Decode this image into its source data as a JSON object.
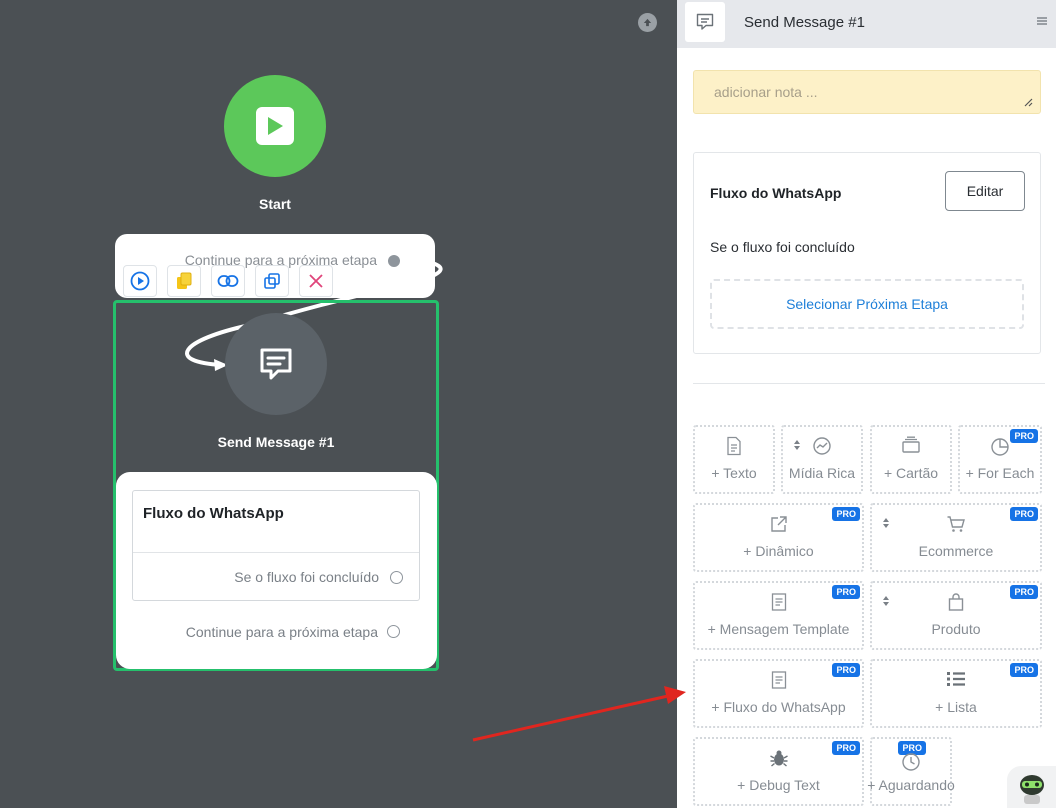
{
  "canvas": {
    "start": {
      "label": "Start",
      "continue_text": "Continue para a próxima etapa"
    },
    "toolbar": {
      "buttons": [
        "play-circle-icon",
        "copy-yellow-icon",
        "link-icon",
        "duplicate-icon",
        "close-icon"
      ]
    },
    "send_message_node": {
      "label": "Send Message #1",
      "whatsapp_box_title": "Fluxo do WhatsApp",
      "condition_text": "Se o fluxo foi concluído",
      "continue_text": "Continue para a próxima etapa"
    },
    "colors": {
      "start_green": "#5cc85a",
      "selection_green": "#25c06c",
      "canvas_bg": "#4b5054"
    }
  },
  "panel": {
    "header": {
      "title": "Send Message #1",
      "icon": "message-icon",
      "menu_icon": "hamburger-icon"
    },
    "note": {
      "placeholder": "adicionar nota ..."
    },
    "flow_card": {
      "title": "Fluxo do WhatsApp",
      "edit_label": "Editar",
      "condition": "Se o fluxo foi concluído",
      "select_next_label": "Selecionar Próxima Etapa"
    },
    "tiles": [
      {
        "label": "+ Texto",
        "icon": "document-icon",
        "pro": ""
      },
      {
        "label": "Mídia Rica",
        "icon": "gauge-icon",
        "pro": ""
      },
      {
        "label": "+ Cartão",
        "icon": "card-icon",
        "pro": ""
      },
      {
        "label": "+ For Each",
        "icon": "pie-icon",
        "pro": "PRO"
      },
      {
        "label": "+ Dinâmico",
        "icon": "external-link-icon",
        "pro": "PRO"
      },
      {
        "label": "Ecommerce",
        "icon": "cart-icon",
        "pro": "PRO"
      },
      {
        "label": "+ Mensagem Template",
        "icon": "template-icon",
        "pro": "PRO"
      },
      {
        "label": "Produto",
        "icon": "bag-icon",
        "pro": "PRO"
      },
      {
        "label": "+ Fluxo do WhatsApp",
        "icon": "flow-icon",
        "pro": "PRO"
      },
      {
        "label": "+ Lista",
        "icon": "list-icon",
        "pro": "PRO"
      },
      {
        "label": "+ Debug Text",
        "icon": "bug-icon",
        "pro": "PRO"
      },
      {
        "label": "+ Aguardando",
        "icon": "clock-icon",
        "pro": "PRO"
      }
    ],
    "colors": {
      "pro_badge": "#1673e6",
      "link_blue": "#1e7fd8",
      "note_bg": "#fdf1c8"
    }
  },
  "annotation": {
    "arrow_color": "#e0261f"
  }
}
